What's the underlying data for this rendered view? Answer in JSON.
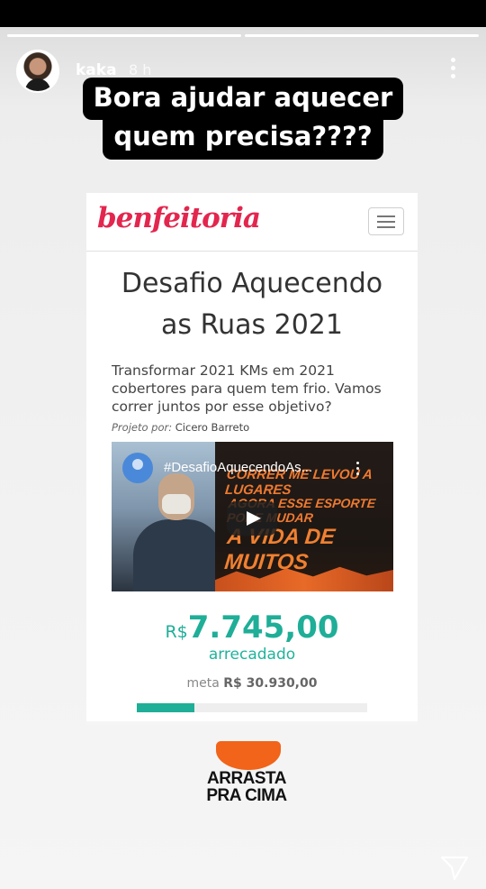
{
  "story": {
    "progress": [
      1,
      1
    ],
    "username": "kaka",
    "time_ago": "8 h",
    "caption_line1": "Bora ajudar aquecer",
    "caption_line2": "quem precisa????"
  },
  "webpage": {
    "logo": "benfeitoria",
    "title_line1": "Desafio Aquecendo",
    "title_line2": "as Ruas 2021",
    "description": "Transformar 2021 KMs em 2021 cobertores para quem tem frio. Vamos correr juntos por esse objetivo?",
    "author_prefix": "Projeto por:",
    "author_name": "Cicero Barreto",
    "video": {
      "title": "#DesafioAquecendoAs...",
      "overlay_line1": "CORRER ME LEVOU A LUGARES",
      "overlay_line2": "AGORA ESSE ESPORTE PODE MUDAR",
      "overlay_line3": "A VIDA DE MUITOS"
    },
    "raised_currency": "R$",
    "raised_amount": "7.745,00",
    "raised_label": "arrecadado",
    "goal_prefix": "meta",
    "goal_amount": "R$ 30.930,00",
    "progress_fraction": 0.25,
    "accent_color": "#1fae97",
    "brand_color": "#e3264e"
  },
  "sticker": {
    "line1": "ARRASTA",
    "line2": "PRA CIMA",
    "color": "#f16419"
  }
}
